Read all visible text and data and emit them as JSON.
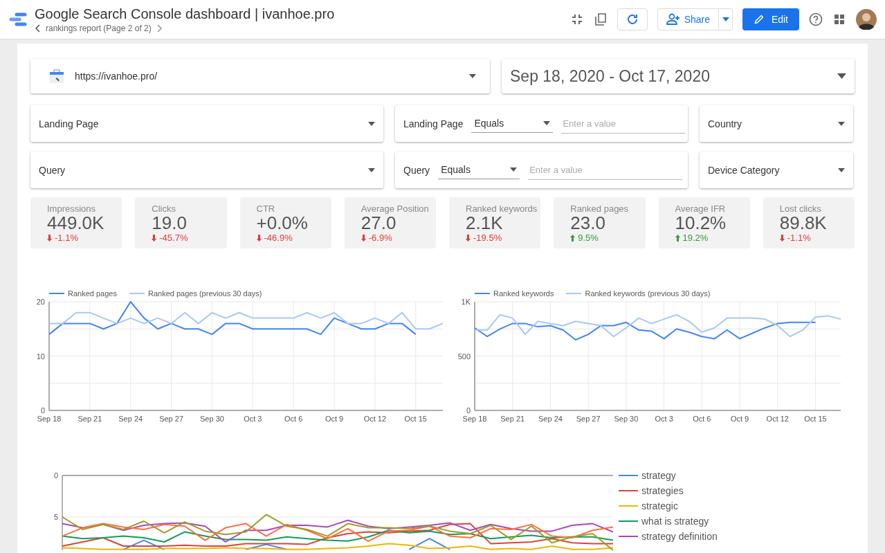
{
  "header": {
    "title": "Google Search Console dashboard | ivanhoe.pro",
    "breadcrumb": "rankings report (Page 2 of 2)",
    "share_label": "Share",
    "edit_label": "Edit"
  },
  "data_source": {
    "url": "https://ivanhoe.pro/"
  },
  "date_range": "Sep 18, 2020 - Oct 17, 2020",
  "controls": [
    {
      "kind": "dropdown",
      "label": "Landing Page"
    },
    {
      "kind": "filter",
      "label": "Landing Page",
      "operator": "Equals",
      "placeholder": "Enter a value"
    },
    {
      "kind": "dropdown",
      "label": "Country"
    },
    {
      "kind": "dropdown",
      "label": "Query"
    },
    {
      "kind": "filter",
      "label": "Query",
      "operator": "Equals",
      "placeholder": "Enter a value"
    },
    {
      "kind": "dropdown",
      "label": "Device Category"
    }
  ],
  "scorecards": [
    {
      "label": "Impressions",
      "value": "449.0K",
      "change": "-1.1%",
      "increase": false
    },
    {
      "label": "Clicks",
      "value": "19.0",
      "change": "-45.7%",
      "increase": false
    },
    {
      "label": "CTR",
      "value": "+0.0%",
      "change": "-46.9%",
      "increase": false
    },
    {
      "label": "Average Position",
      "value": "27.0",
      "change": "-6.9%",
      "increase": false
    },
    {
      "label": "Ranked keywords",
      "value": "2.1K",
      "change": "-19.5%",
      "increase": false
    },
    {
      "label": "Ranked pages",
      "value": "23.0",
      "change": "9.5%",
      "increase": true
    },
    {
      "label": "Average IFR",
      "value": "10.2%",
      "change": "19.2%",
      "increase": true
    },
    {
      "label": "Lost clicks",
      "value": "89.8K",
      "change": "-1.1%",
      "increase": false
    }
  ],
  "charts": [
    {
      "chart_data": {
        "type": "line",
        "grid": true,
        "legend": "top",
        "ylim": [
          0,
          20
        ],
        "yticks": [
          0,
          10,
          20
        ],
        "categories": [
          "Sep 18",
          null,
          null,
          "Sep 21",
          null,
          null,
          "Sep 24",
          null,
          null,
          "Sep 27",
          null,
          null,
          "Sep 30",
          null,
          null,
          "Oct 3",
          null,
          null,
          "Oct 6",
          null,
          null,
          "Oct 9",
          null,
          null,
          "Oct 12",
          null,
          null,
          "Oct 15",
          null,
          null
        ],
        "series": [
          {
            "name": "Ranked pages",
            "color": "#4285f4",
            "values": [
              14,
              16,
              16,
              16,
              15,
              16,
              20,
              17,
              15,
              16,
              15,
              15,
              14,
              16,
              16,
              15,
              15,
              15,
              15,
              15,
              14,
              17,
              16,
              15,
              15,
              16,
              16,
              14,
              null,
              null
            ]
          },
          {
            "name": "Ranked pages (previous 30 days)",
            "color": "#a8c7fa",
            "values": [
              16,
              16,
              18,
              18,
              17,
              16,
              17,
              16,
              17,
              16,
              18,
              16,
              18,
              17,
              18,
              17,
              17,
              17,
              17,
              18,
              17,
              18,
              16,
              16,
              17,
              16,
              18,
              15,
              15,
              16
            ]
          }
        ]
      }
    },
    {
      "chart_data": {
        "type": "line",
        "grid": true,
        "legend": "top",
        "ylim": [
          0,
          1000
        ],
        "yticks": [
          0,
          500,
          {
            "value": 1000,
            "label": "1K"
          }
        ],
        "categories": [
          "Sep 18",
          null,
          null,
          "Sep 21",
          null,
          null,
          "Sep 24",
          null,
          null,
          "Sep 27",
          null,
          null,
          "Sep 30",
          null,
          null,
          "Oct 3",
          null,
          null,
          "Oct 6",
          null,
          null,
          "Oct 9",
          null,
          null,
          "Oct 12",
          null,
          null,
          "Oct 15",
          null,
          null
        ],
        "series": [
          {
            "name": "Ranked keywords",
            "color": "#4285f4",
            "values": [
              760,
              680,
              750,
              800,
              800,
              770,
              780,
              740,
              650,
              700,
              780,
              780,
              810,
              740,
              730,
              660,
              750,
              720,
              680,
              660,
              740,
              660,
              710,
              760,
              800,
              810,
              810,
              810,
              null,
              null
            ]
          },
          {
            "name": "Ranked keywords (previous 30 days)",
            "color": "#a8c7fa",
            "values": [
              740,
              740,
              880,
              850,
              700,
              820,
              800,
              780,
              820,
              800,
              780,
              680,
              760,
              850,
              800,
              840,
              880,
              820,
              720,
              760,
              850,
              850,
              850,
              840,
              780,
              680,
              740,
              860,
              870,
              840
            ]
          }
        ]
      }
    },
    {
      "chart_data": {
        "type": "line",
        "grid": true,
        "legend": "right",
        "ylim": [
          9,
          0
        ],
        "yticks": [
          0,
          5
        ],
        "series": [
          {
            "name": "strategy",
            "color": "#4285f4",
            "values": [
              null,
              null,
              null,
              8.9,
              7.8,
              8.9,
              null,
              null,
              null,
              8.9,
              8.3,
              8.9,
              null,
              null,
              null,
              null,
              null,
              8.9,
              7.6,
              8.9,
              null,
              null,
              null,
              null,
              null,
              null,
              null,
              null
            ]
          },
          {
            "name": "strategies",
            "color": "#db4437",
            "values": [
              8.5,
              8,
              7.5,
              8.5,
              8.5,
              8.5,
              8.4,
              8.5,
              8.5,
              8.2,
              8.2,
              8.2,
              8.3,
              7.5,
              7,
              6.8,
              6.9,
              6.7,
              6.6,
              5.9,
              5.8,
              8.2,
              8.1,
              8,
              7.6,
              8.1,
              8.2,
              8.2
            ]
          },
          {
            "name": "strategic",
            "color": "#f4b400",
            "values": [
              8.7,
              8.8,
              8.9,
              8.9,
              8.9,
              8.8,
              8.8,
              8.8,
              8.7,
              8.8,
              8.8,
              8.9,
              8.9,
              8.8,
              8.7,
              8.5,
              8.2,
              8.4,
              8.8,
              8.7,
              8.5,
              8.9,
              8.8,
              8.9,
              8.5,
              8.9,
              8.9,
              8.7
            ]
          },
          {
            "name": "what is strategy",
            "color": "#0f9d58",
            "values": [
              7.3,
              7.6,
              7.5,
              7.3,
              7.5,
              8,
              6.8,
              7.3,
              7.7,
              7.7,
              7.8,
              7.4,
              7.6,
              7.8,
              7.9,
              7.4,
              6.6,
              6.9,
              6.7,
              7.1,
              7,
              7.6,
              7.4,
              7.2,
              7.5,
              7.4,
              7.4,
              7.8
            ]
          },
          {
            "name": "strategy definition",
            "color": "#ab47bc",
            "values": [
              5.8,
              6.3,
              5.9,
              6.6,
              6,
              5.8,
              5.7,
              6.1,
              8,
              6.6,
              6.6,
              6,
              6,
              6.2,
              5.4,
              6.1,
              6.4,
              6.2,
              6,
              5.7,
              6.6,
              5.9,
              6.4,
              6.7,
              6.7,
              6,
              5.8,
              6.8
            ]
          },
          {
            "color": "#ff7043",
            "values": [
              7.3,
              6.3,
              5.8,
              6.2,
              6.5,
              5.9,
              6.1,
              7.8,
              6.3,
              5.8,
              7.3,
              5.9,
              6.6,
              7.6,
              6.4,
              7.9,
              6.7,
              6.6,
              6.1,
              7.3,
              7.5,
              6.4,
              6.5,
              5.9,
              7.3,
              7.5,
              6.6,
              6.2
            ]
          },
          {
            "color": "#9e9d24",
            "values": [
              5,
              6.5,
              5.9,
              6.5,
              5.5,
              6.9,
              5.6,
              6.7,
              7.1,
              6.8,
              4.7,
              6.1,
              6.5,
              7.3,
              5.8,
              6.3,
              6.3,
              6.4,
              6.1,
              6.7,
              7,
              6,
              7.7,
              6.1,
              8.1,
              7.4,
              7,
              9
            ]
          }
        ]
      }
    }
  ]
}
